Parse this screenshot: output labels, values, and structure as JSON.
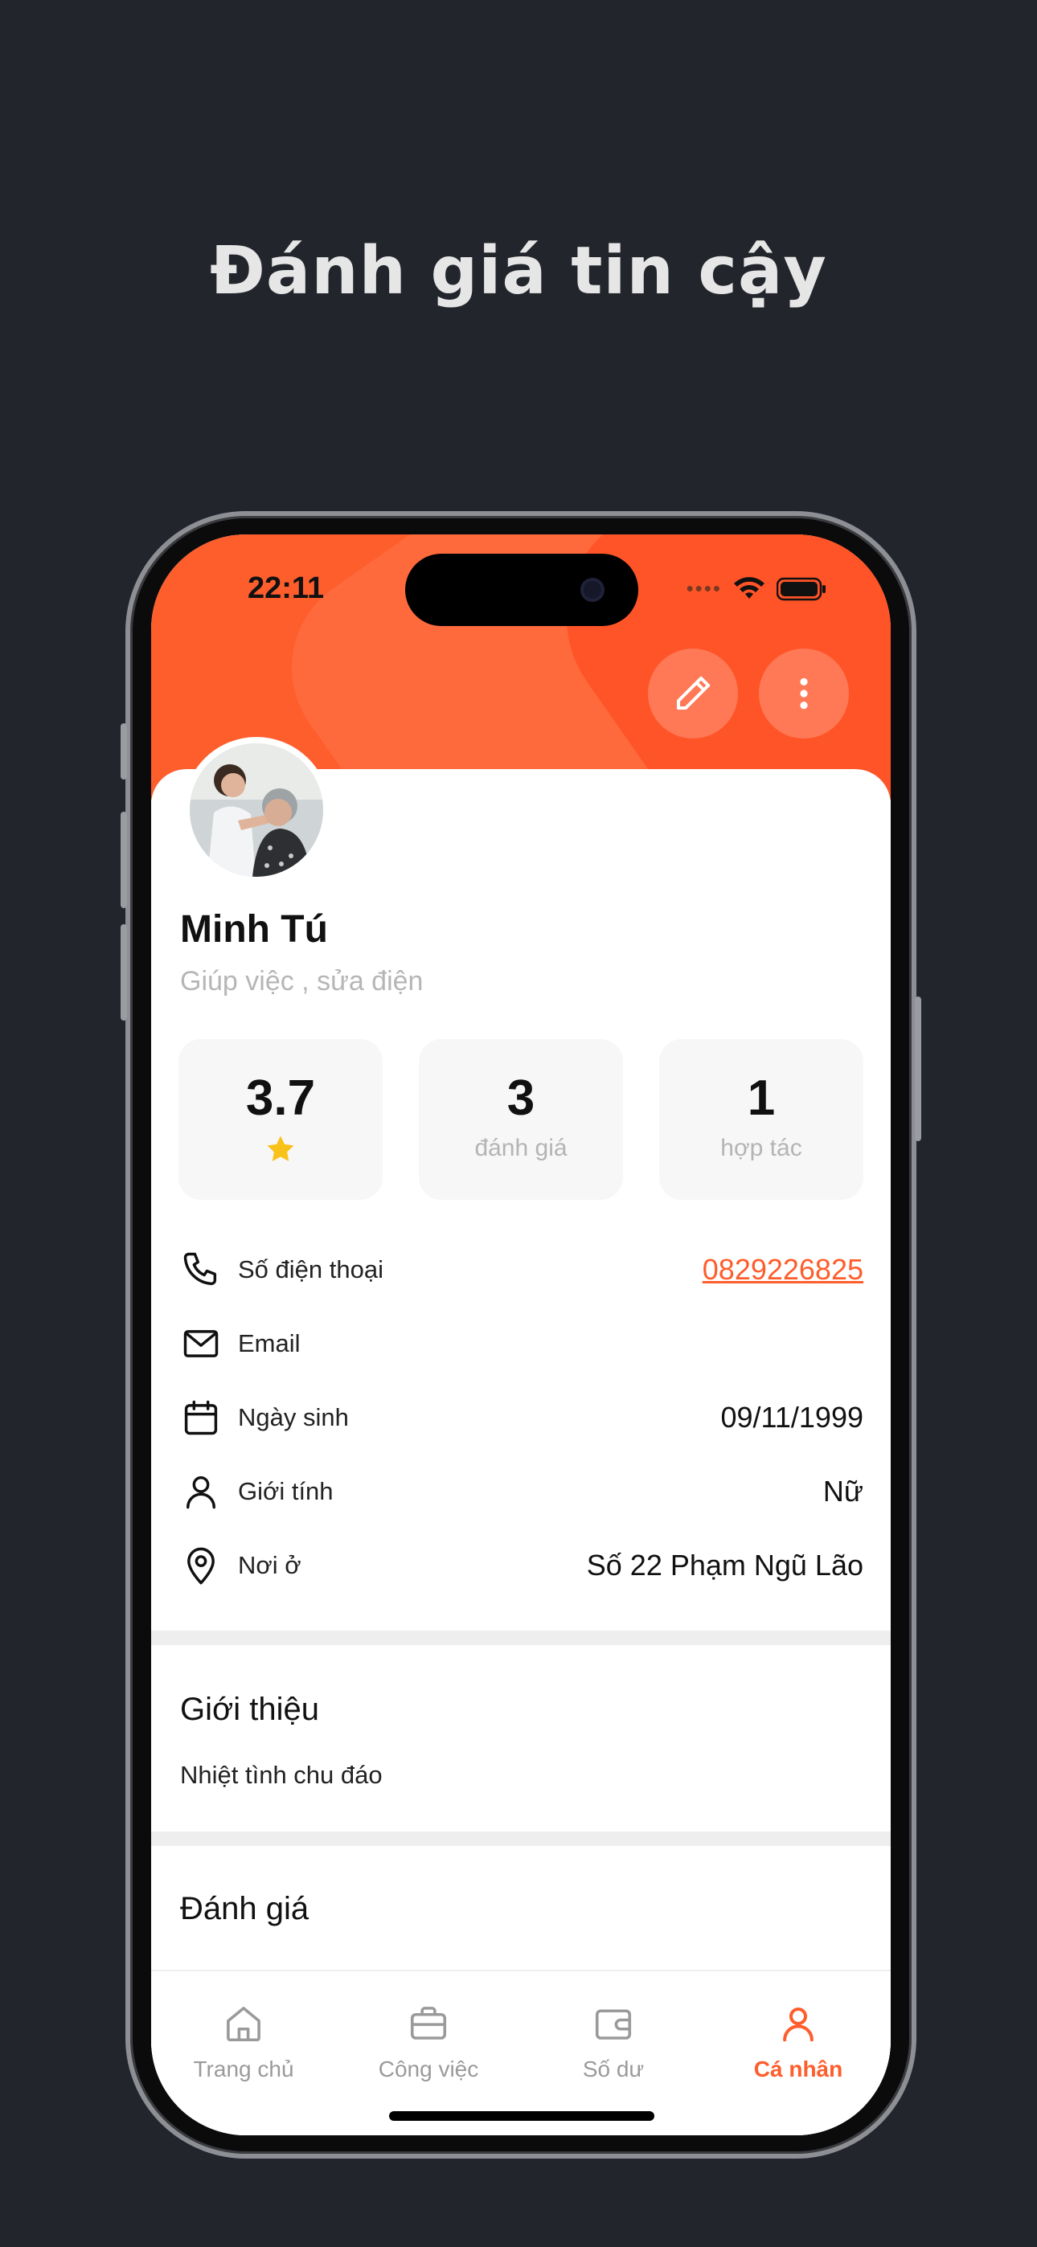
{
  "headline": "Đánh giá tin cậy",
  "status_bar": {
    "time": "22:11"
  },
  "profile": {
    "name": "Minh Tú",
    "services": "Giúp việc , sửa điện"
  },
  "stats": [
    {
      "value": "3.7",
      "label": "",
      "icon": "star-icon"
    },
    {
      "value": "3",
      "label": "đánh giá"
    },
    {
      "value": "1",
      "label": "hợp tác"
    }
  ],
  "info": {
    "phone": {
      "label": "Số điện thoại",
      "value": "0829226825",
      "icon": "phone-icon"
    },
    "email": {
      "label": "Email",
      "value": "",
      "icon": "mail-icon"
    },
    "birthday": {
      "label": "Ngày sinh",
      "value": "09/11/1999",
      "icon": "calendar-icon"
    },
    "gender": {
      "label": "Giới tính",
      "value": "Nữ",
      "icon": "person-icon"
    },
    "address": {
      "label": "Nơi ở",
      "value": "Số 22 Phạm Ngũ Lão",
      "icon": "location-pin-icon"
    }
  },
  "about": {
    "title": "Giới thiệu",
    "text": "Nhiệt tình chu đáo"
  },
  "reviews": {
    "title": "Đánh giá"
  },
  "tabs": [
    {
      "label": "Trang chủ",
      "icon": "home-icon"
    },
    {
      "label": "Công việc",
      "icon": "briefcase-icon"
    },
    {
      "label": "Số dư",
      "icon": "wallet-icon"
    },
    {
      "label": "Cá nhân",
      "icon": "person-icon",
      "active": true
    }
  ],
  "colors": {
    "accent": "#fe5d2c",
    "background": "#22252c",
    "star": "#f9c21a"
  }
}
